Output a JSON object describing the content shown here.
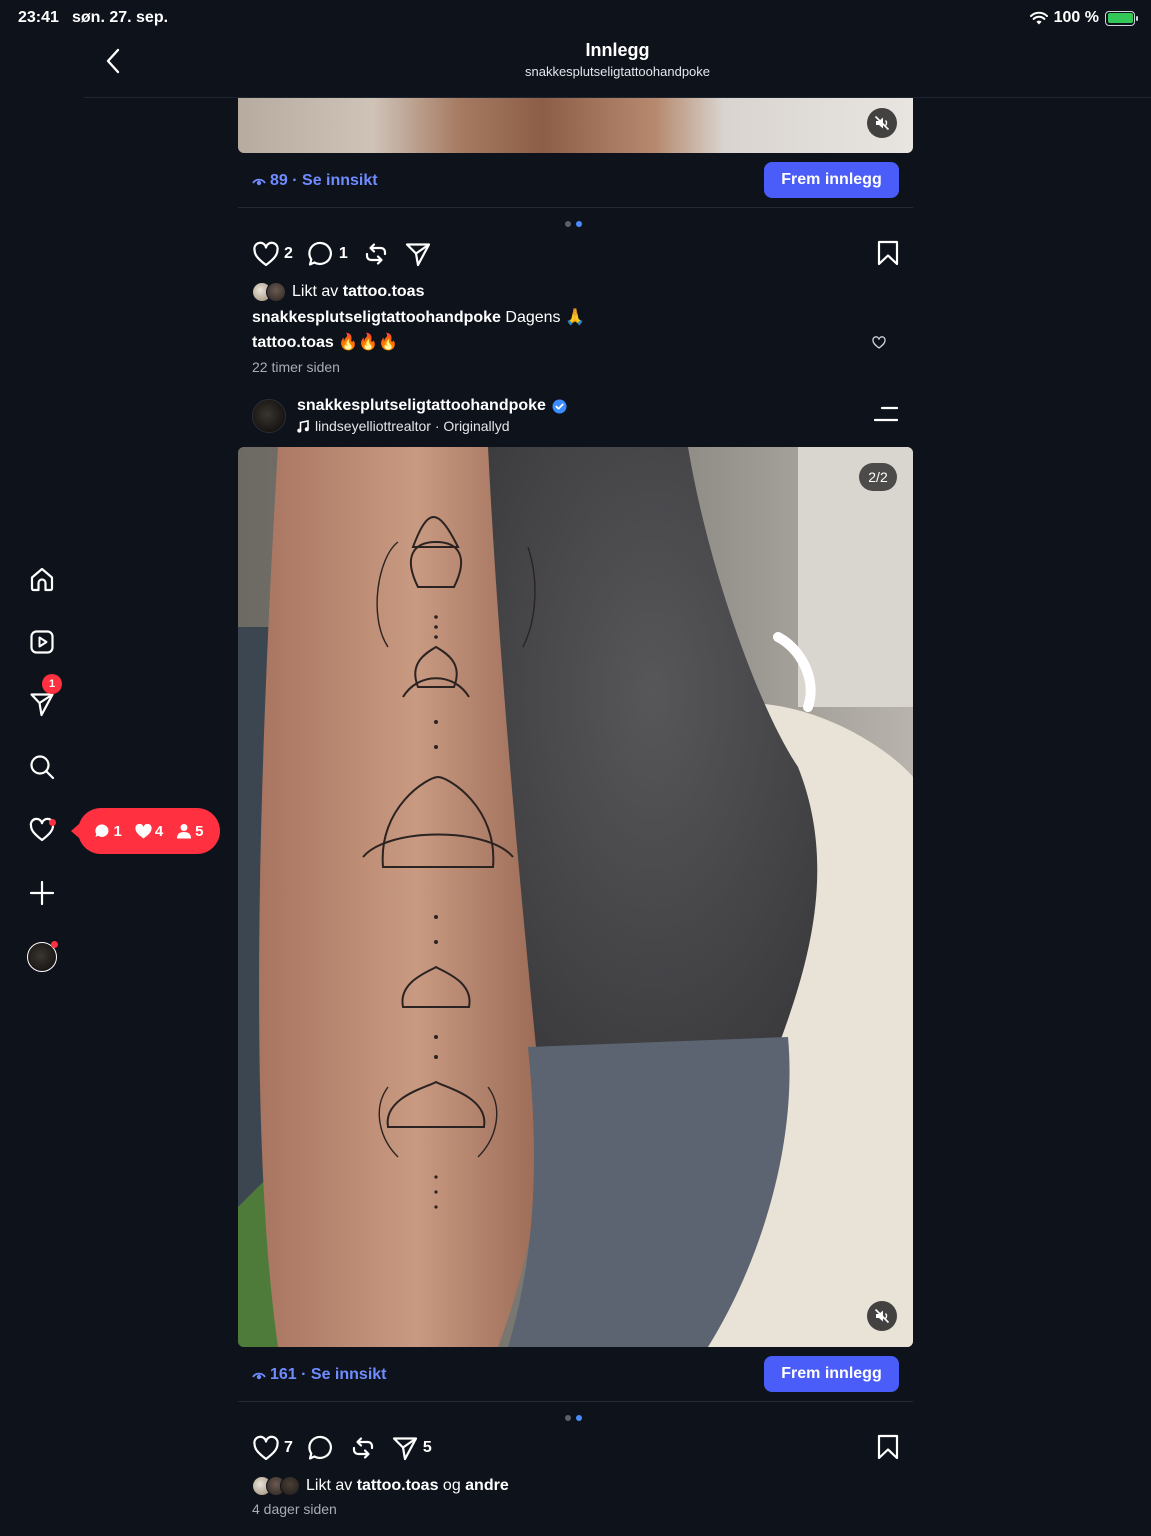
{
  "status": {
    "time": "23:41",
    "date": "søn. 27. sep.",
    "battery": "100 %"
  },
  "header": {
    "title": "Innlegg",
    "subtitle": "snakkesplutseligtattoohandpoke"
  },
  "sidebar": {
    "items": [
      {
        "name": "home-icon"
      },
      {
        "name": "reels-icon"
      },
      {
        "name": "direct-icon",
        "badge": "1"
      },
      {
        "name": "search-icon"
      },
      {
        "name": "activity-heart-icon"
      },
      {
        "name": "create-plus-icon"
      },
      {
        "name": "profile-avatar"
      }
    ]
  },
  "notifications": {
    "comments": "1",
    "likes": "4",
    "follows": "5"
  },
  "post1": {
    "insight": "89 · Se innsikt",
    "promote": "Frem innlegg",
    "likes": "2",
    "comments": "1",
    "liked_by_prefix": "Likt av ",
    "liked_by_user": "tattoo.toas",
    "caption_user": "snakkesplutseligtattoohandpoke",
    "caption_text": " Dagens 🙏",
    "comment_user": "tattoo.toas",
    "comment_text": " 🔥🔥🔥",
    "time": "22 timer siden"
  },
  "post2": {
    "user": "snakkesplutseligtattoohandpoke",
    "audio": "lindseyelliottrealtor · Originallyd",
    "counter": "2/2",
    "insight": "161 · Se innsikt",
    "promote": "Frem innlegg",
    "likes": "7",
    "shares": "5",
    "liked_by_prefix": "Likt av ",
    "liked_by_user": "tattoo.toas",
    "liked_by_and": " og ",
    "liked_by_others": "andre",
    "time": "4 dager siden"
  },
  "colors": {
    "accent": "#4a5df9",
    "link": "#6f8cff",
    "badge": "#ff3040",
    "verified": "#3b8cff",
    "background": "#0e121b"
  }
}
